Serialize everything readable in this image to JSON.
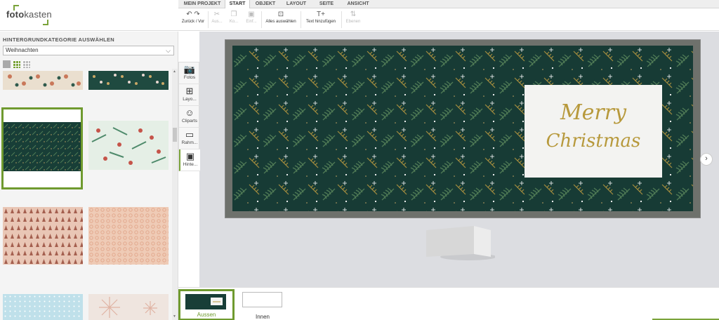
{
  "brand": {
    "logo_text_pre": "foto",
    "logo_text_post": "kasten"
  },
  "tabs": [
    {
      "label": "MEIN PROJEKT",
      "active": false
    },
    {
      "label": "START",
      "active": true
    },
    {
      "label": "OBJEKT",
      "active": false
    },
    {
      "label": "LAYOUT",
      "active": false
    },
    {
      "label": "SEITE",
      "active": false
    },
    {
      "label": "ANSICHT",
      "active": false
    }
  ],
  "toolbar": {
    "undo_redo": "Zurück / Vor",
    "cut": "Aus...",
    "copy": "Ko...",
    "paste": "Einf...",
    "select_all": "Alles auswählen",
    "add_text": "Text hinzufügen",
    "layers": "Ebenen"
  },
  "left_panel": {
    "title": "HINTERGRUNDKATEGORIE AUSWÄHLEN",
    "category_value": "Weihnachten"
  },
  "sidebar": {
    "items": [
      {
        "label": "Fotos",
        "icon": "camera-icon"
      },
      {
        "label": "Layo...",
        "icon": "layout-icon"
      },
      {
        "label": "Cliparts",
        "icon": "smiley-icon"
      },
      {
        "label": "Rahm...",
        "icon": "frame-icon"
      },
      {
        "label": "Hinte...",
        "icon": "background-icon"
      }
    ]
  },
  "canvas": {
    "text_line1": "Merry",
    "text_line2": "Christmas"
  },
  "pages": [
    {
      "label": "Aussen",
      "active": true
    },
    {
      "label": "Innen",
      "active": false
    }
  ],
  "colors": {
    "accent": "#7aa33a",
    "card_green": "#173b35",
    "gold": "#b7993c"
  }
}
